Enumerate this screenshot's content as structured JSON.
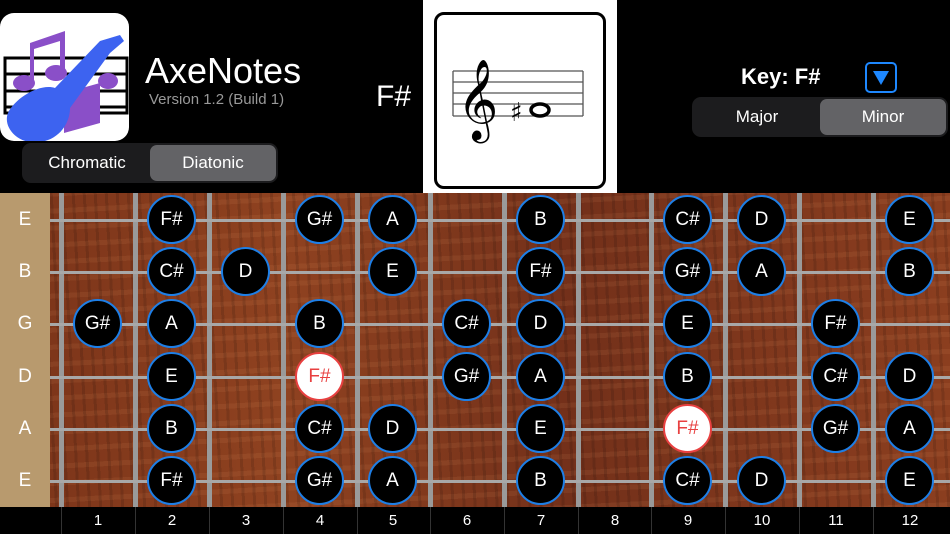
{
  "app": {
    "title": "AxeNotes",
    "version": "Version 1.2 (Build 1)"
  },
  "mode": {
    "options": [
      "Chromatic",
      "Diatonic"
    ],
    "selected": 1
  },
  "current_note": "F#",
  "key": {
    "label": "Key: F#",
    "options": [
      "Major",
      "Minor"
    ],
    "selected": 1
  },
  "colors": {
    "accent": "#1e7fe6",
    "root": "#e84040",
    "segment_selected": "#636366"
  },
  "strings": [
    "E",
    "B",
    "G",
    "D",
    "A",
    "E"
  ],
  "fret_numbers": [
    "1",
    "2",
    "3",
    "4",
    "5",
    "6",
    "7",
    "8",
    "9",
    "10",
    "11",
    "12"
  ],
  "root_note": "F#",
  "fretboard": [
    [
      "",
      "F#",
      "",
      "G#",
      "A",
      "",
      "B",
      "",
      "C#",
      "D",
      "",
      "E"
    ],
    [
      "",
      "C#",
      "D",
      "",
      "E",
      "",
      "F#",
      "",
      "G#",
      "A",
      "",
      "B"
    ],
    [
      "G#",
      "A",
      "",
      "B",
      "",
      "C#",
      "D",
      "",
      "E",
      "",
      "F#",
      ""
    ],
    [
      "",
      "E",
      "",
      "F#",
      "",
      "G#",
      "A",
      "",
      "B",
      "",
      "C#",
      "D"
    ],
    [
      "",
      "B",
      "",
      "C#",
      "D",
      "",
      "E",
      "",
      "F#",
      "",
      "G#",
      "A"
    ],
    [
      "",
      "F#",
      "",
      "G#",
      "A",
      "",
      "B",
      "",
      "C#",
      "D",
      "",
      "E"
    ]
  ],
  "root_positions": [
    [
      3,
      3
    ],
    [
      4,
      8
    ]
  ]
}
